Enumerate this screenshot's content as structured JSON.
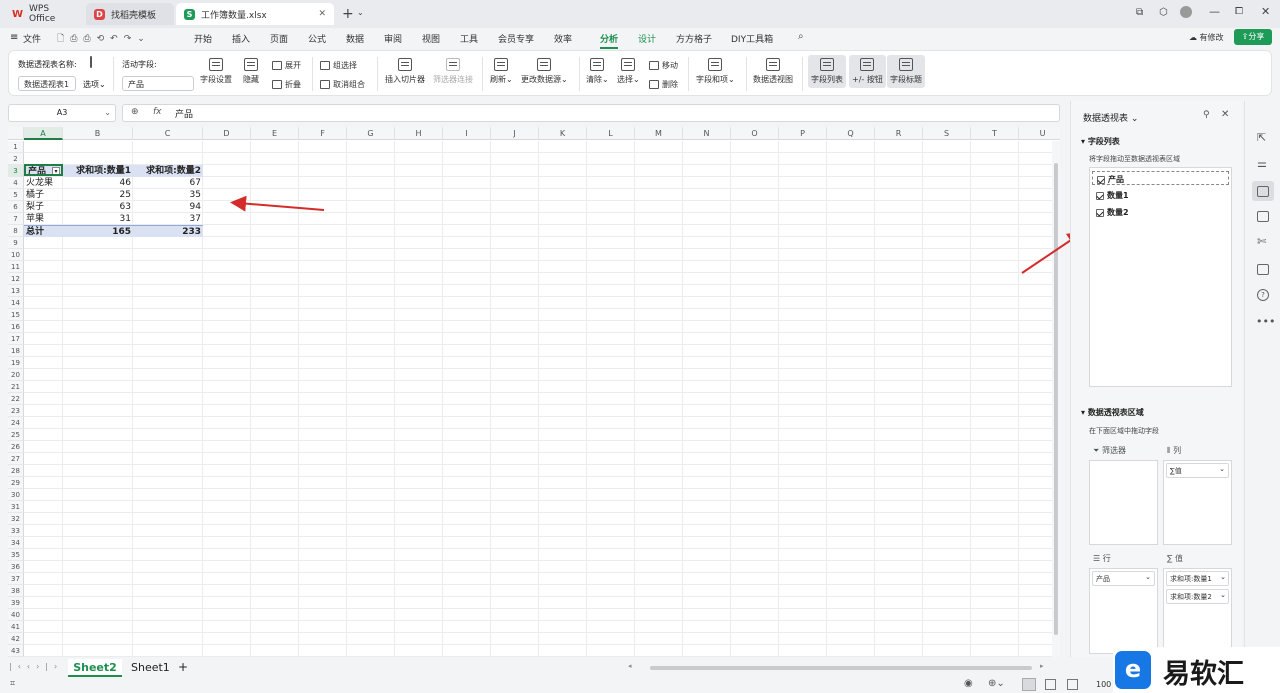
{
  "tabs": [
    {
      "label": "WPS Office"
    },
    {
      "label": "找稻壳模板"
    },
    {
      "label": "工作簿数量.xlsx"
    }
  ],
  "menu": {
    "file": "文件",
    "items": [
      "开始",
      "插入",
      "页面",
      "公式",
      "数据",
      "审阅",
      "视图",
      "工具",
      "会员专享",
      "效率",
      "分析",
      "设计",
      "方方格子",
      "DIY工具箱"
    ],
    "active": "分析",
    "modify": "有修改",
    "share": "分享"
  },
  "ribbon": {
    "pivot_name_label": "数据透视表名称:",
    "pivot_name_value": "数据透视表1",
    "options": "选项",
    "active_field_label": "活动字段:",
    "active_field_value": "产品",
    "field_settings": "字段设置",
    "hide": "隐藏",
    "expand": "展开",
    "collapse": "折叠",
    "group_select": "组选择",
    "ungroup": "取消组合",
    "insert_slicer": "插入切片器",
    "filter_connect": "筛选器连接",
    "refresh": "刷新",
    "change_source": "更改数据源",
    "clear": "清除",
    "select": "选择",
    "move": "移动",
    "delete": "删除",
    "fields_items": "字段和项",
    "pivot_view": "数据透视图",
    "field_list": "字段列表",
    "plus_minus": "+/- 按钮",
    "field_headers": "字段标题"
  },
  "formula": {
    "namebox": "A3",
    "fx": "fx",
    "content": "产品"
  },
  "columns": [
    "A",
    "B",
    "C",
    "D",
    "E",
    "F",
    "G",
    "H",
    "I",
    "J",
    "K",
    "L",
    "M",
    "N",
    "O",
    "P",
    "Q",
    "R",
    "S",
    "T",
    "U"
  ],
  "table": {
    "headers": [
      "产品",
      "求和项:数量1",
      "求和项:数量2"
    ],
    "rows": [
      [
        "火龙果",
        "46",
        "67"
      ],
      [
        "橘子",
        "25",
        "35"
      ],
      [
        "梨子",
        "63",
        "94"
      ],
      [
        "苹果",
        "31",
        "37"
      ]
    ],
    "total": [
      "总计",
      "165",
      "233"
    ]
  },
  "sheets": {
    "active": "Sheet2",
    "other": "Sheet1",
    "add": "+"
  },
  "status": {
    "zoom": "100"
  },
  "panel": {
    "title": "数据透视表",
    "field_list_title": "字段列表",
    "field_list_hint": "将字段拖动至数据透视表区域",
    "fields": [
      "产品",
      "数量1",
      "数量2"
    ],
    "area_title": "数据透视表区域",
    "area_hint": "在下面区域中拖动字段",
    "filter_label": "筛选器",
    "column_label": "列",
    "row_label": "行",
    "value_label": "值",
    "column_item": "∑值",
    "row_item": "产品",
    "value_items": [
      "求和项:数量1",
      "求和项:数量2"
    ]
  },
  "watermark": {
    "text": "易软汇"
  }
}
